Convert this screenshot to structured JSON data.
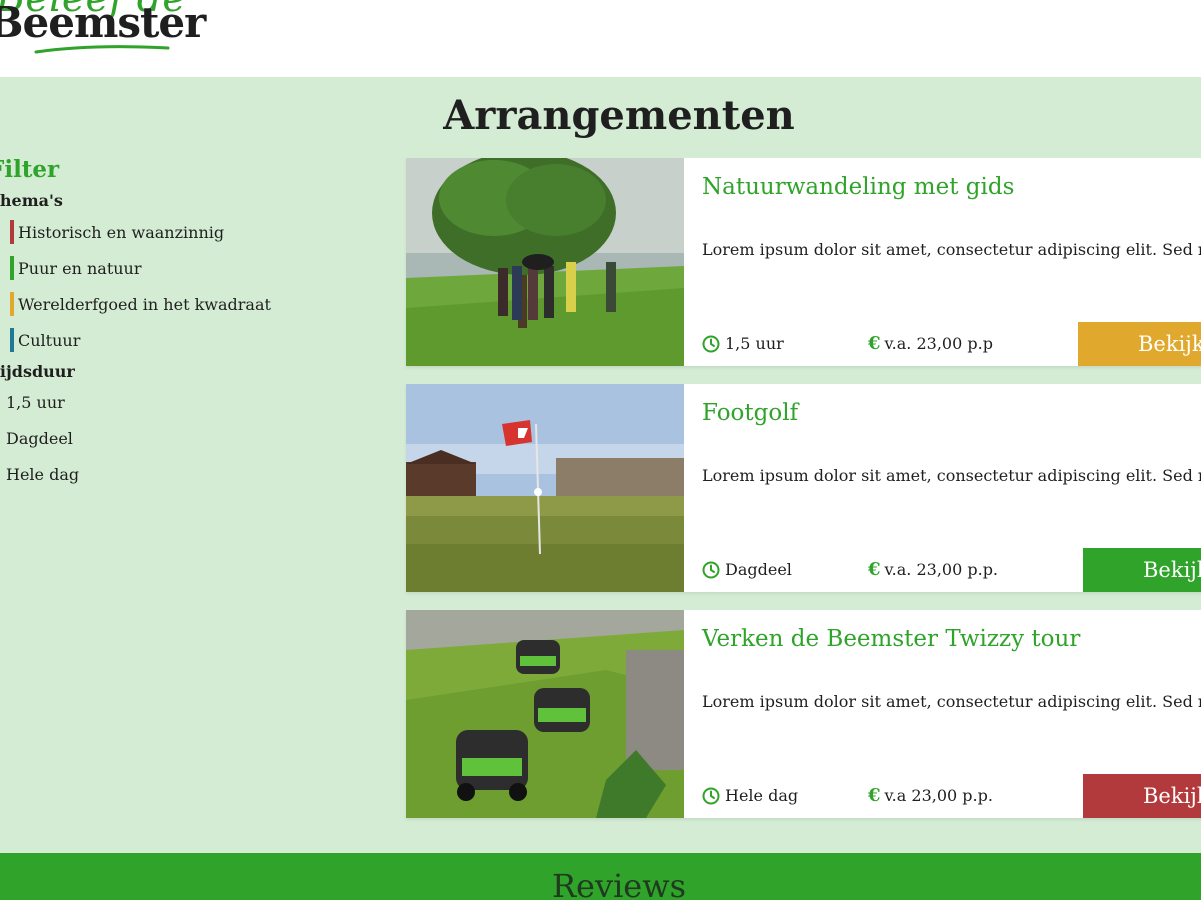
{
  "logo": {
    "top_text": "Beleef de",
    "main_text": "Beemster"
  },
  "page": {
    "title": "Arrangementen"
  },
  "filter": {
    "title": "Filter",
    "themes_title": "Thema's",
    "themes": [
      {
        "label": "Historisch en waanzinnig",
        "color": "#b33a3c"
      },
      {
        "label": "Puur en natuur",
        "color": "#2fa32a"
      },
      {
        "label": "Werelderfgoed in het kwadraat",
        "color": "#e0a82c"
      },
      {
        "label": "Cultuur",
        "color": "#1f7a96"
      }
    ],
    "duration_title": "Tijdsduur",
    "durations": [
      "1,5 uur",
      "Dagdeel",
      "Hele dag"
    ]
  },
  "cards": [
    {
      "title": "Natuurwandeling met gids",
      "description": "Lorem ipsum dolor sit amet, consectetur adipiscing elit. Sed maximus",
      "duration": "1,5 uur",
      "price": "v.a. 23,00 p.p",
      "button": "Bekijk",
      "button_color": "#e0a82c",
      "image": "group-under-tree-on-dike"
    },
    {
      "title": "Footgolf",
      "description": "Lorem ipsum dolor sit amet, consectetur adipiscing elit. Sed maximus",
      "duration": "Dagdeel",
      "price": "v.a. 23,00 p.p.",
      "button": "Bekijk",
      "button_color": "#2fa32a",
      "image": "footgolf-flag-on-field"
    },
    {
      "title": "Verken de Beemster Twizzy tour",
      "description": "Lorem ipsum dolor sit amet, consectetur adipiscing elit. Sed maximus",
      "duration": "Hele dag",
      "price": "v.a 23,00 p.p.",
      "button": "Bekijk",
      "button_color": "#b33a3c",
      "image": "twizzy-cars-on-grass"
    }
  ],
  "reviews": {
    "title": "Reviews"
  },
  "colors": {
    "brand_green": "#2fa32a",
    "background": "#d4ecd4"
  }
}
